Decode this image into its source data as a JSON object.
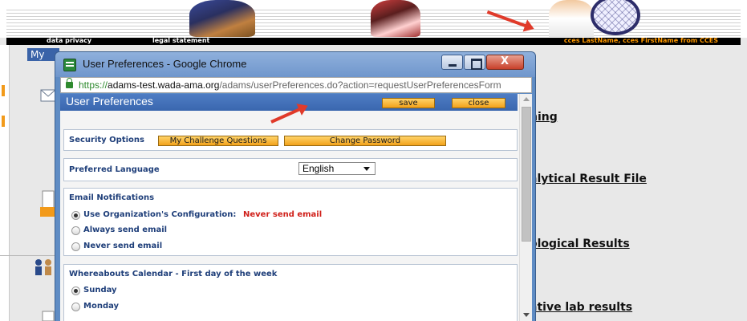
{
  "site": {
    "links": {
      "privacy": "data privacy",
      "legal": "legal statement"
    },
    "user_info": "cces LastName, cces FirstName from CCES",
    "tab_label": "My",
    "menu_links": [
      "hing",
      "alytical Result File",
      "ological Results",
      "ative lab results"
    ]
  },
  "browser": {
    "window_title": "User Preferences - Google Chrome",
    "url_scheme": "https://",
    "url_host": "adams-test.wada-ama.org",
    "url_path": "/adams/userPreferences.do?action=requestUserPreferencesForm"
  },
  "preferences": {
    "title": "User Preferences",
    "save_label": "save",
    "close_label": "close",
    "security": {
      "label": "Security Options",
      "challenge_label": "My Challenge Questions",
      "password_label": "Change Password"
    },
    "language": {
      "label": "Preferred Language",
      "value": "English"
    },
    "email": {
      "label": "Email Notifications",
      "option_org": "Use Organization's Configuration:",
      "option_org_value": "Never send email",
      "option_always": "Always send email",
      "option_never": "Never send email"
    },
    "week": {
      "label": "Whereabouts Calendar - First day of the week",
      "option_sunday": "Sunday",
      "option_monday": "Monday"
    }
  },
  "colors": {
    "accent": "#3a66ae",
    "button": "#f2a21a",
    "annotation_arrow": "#e03a2a",
    "warning_text": "#d0201a",
    "user_info_text": "#ff9900"
  }
}
